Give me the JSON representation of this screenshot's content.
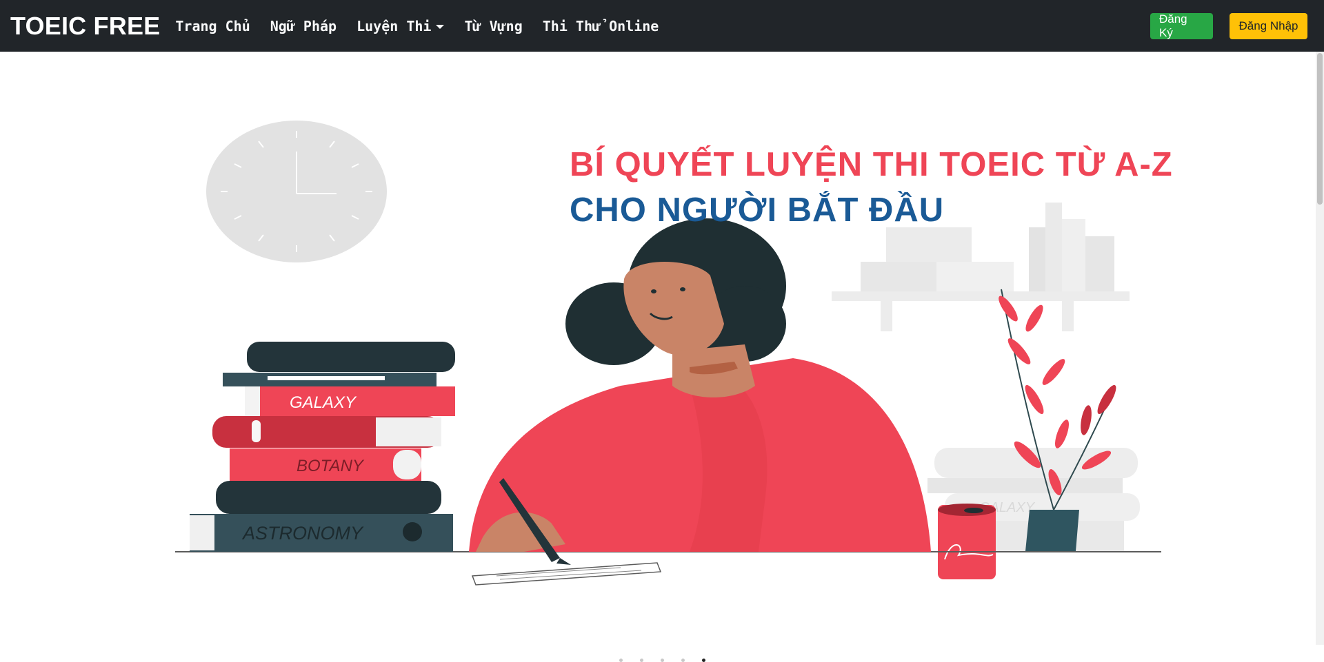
{
  "navbar": {
    "brand": "TOEIC FREE",
    "links": [
      {
        "label": "Trang Chủ"
      },
      {
        "label": "Ngữ Pháp"
      },
      {
        "label": "Luyện Thi",
        "dropdown": true
      },
      {
        "label": "Từ Vựng"
      },
      {
        "label": "Thi Thử Online"
      }
    ],
    "register_label": "Đăng Ký",
    "login_label": "Đăng Nhập"
  },
  "hero": {
    "headline_line1": "BÍ QUYẾT LUYỆN THI TOEIC TỪ A-Z",
    "headline_line2": "CHO NGƯỜI BẮT ĐẦU",
    "book_labels": [
      "GALAXY",
      "BOTANY",
      "ASTRONOMY",
      "GALAXY"
    ]
  },
  "carousel": {
    "slide_count": 5,
    "active_index": 4
  },
  "colors": {
    "navbar_bg": "#212529",
    "register_btn": "#28a745",
    "login_btn": "#ffc107",
    "headline_red": "#ef4556",
    "headline_blue": "#1a5a96"
  }
}
